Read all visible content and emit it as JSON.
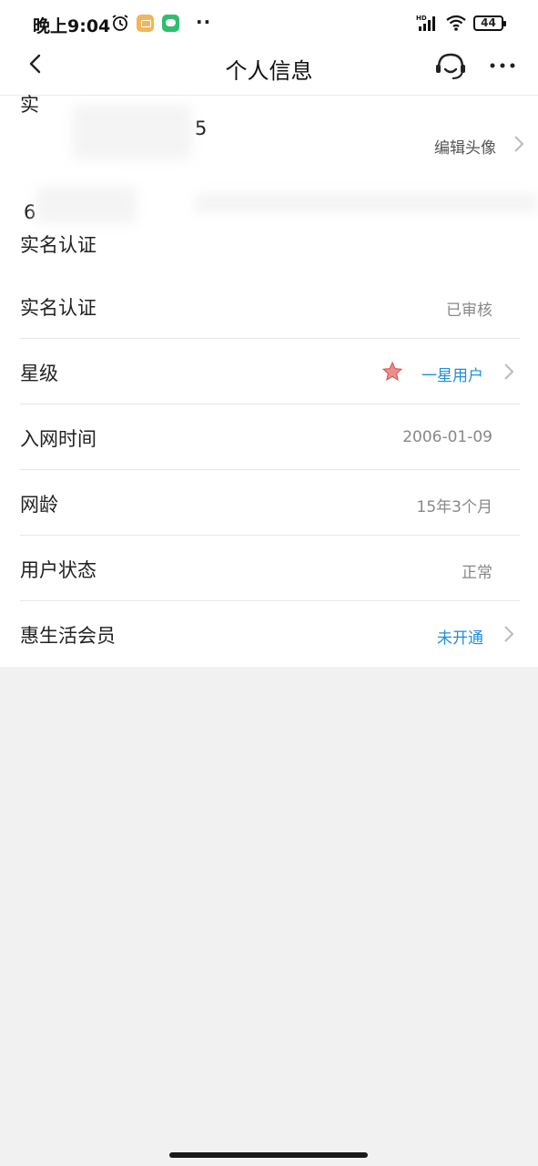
{
  "status_bar": {
    "time": "晚上9:04",
    "dots": "··",
    "battery": "44"
  },
  "nav": {
    "title": "个人信息"
  },
  "avatar_section": {
    "edit_label": "编辑头像",
    "obscured_fragments": [
      "实",
      "5",
      "6",
      "实名认证"
    ]
  },
  "rows": [
    {
      "label": "实名认证",
      "value": "已审核"
    },
    {
      "label": "星级",
      "value": "一星用户"
    },
    {
      "label": "入网时间",
      "value": "2006-01-09"
    },
    {
      "label": "网龄",
      "value": "15年3个月"
    },
    {
      "label": "用户状态",
      "value": "正常"
    },
    {
      "label": "惠生活会员",
      "value": "未开通"
    }
  ],
  "colors": {
    "link": "#1f8ed9",
    "star": "#e24a4a",
    "background": "#f1f1f1"
  }
}
